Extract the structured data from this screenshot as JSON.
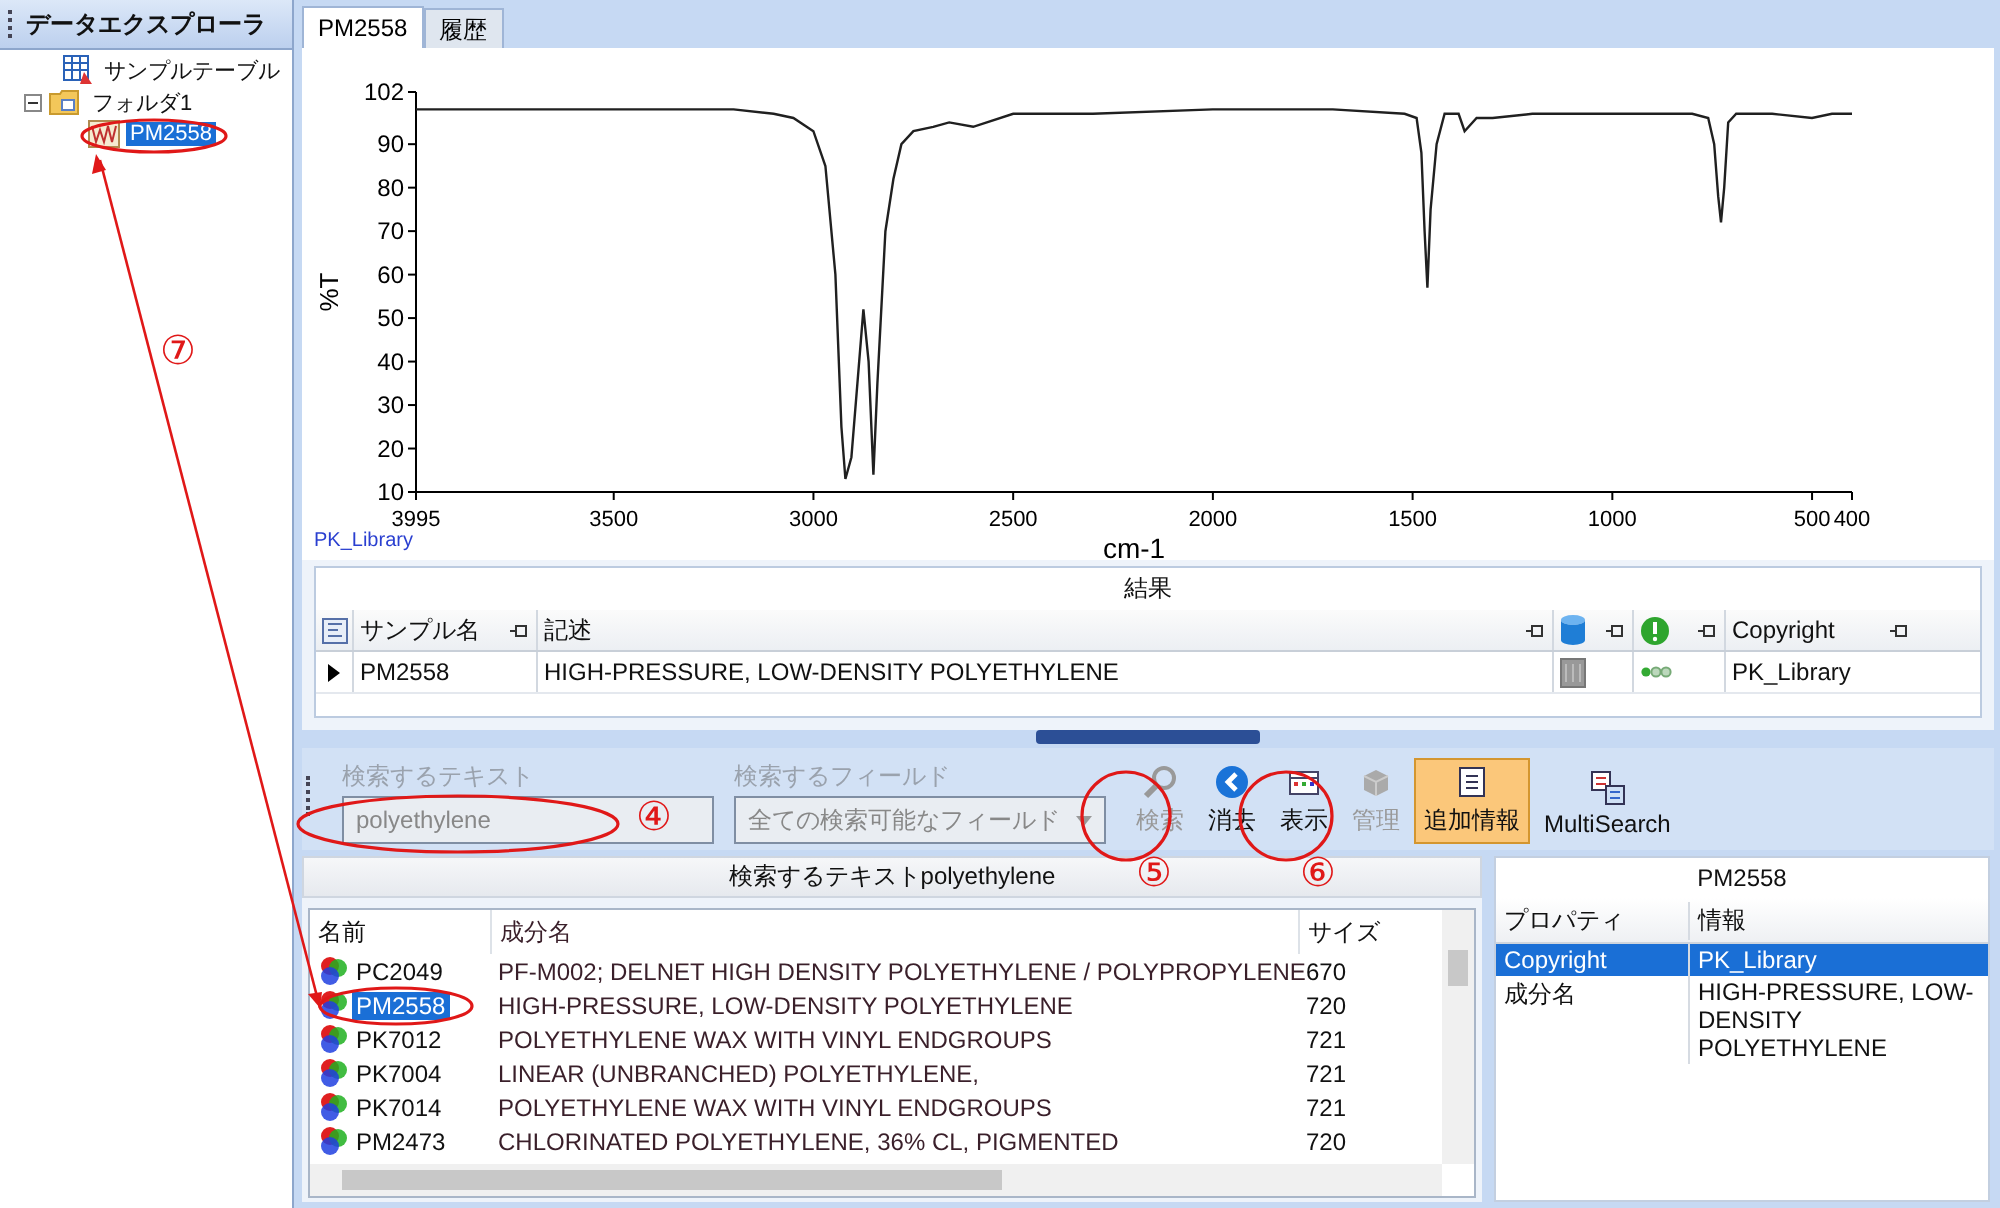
{
  "explorer": {
    "title": "データエクスプローラ",
    "tree": [
      {
        "label": "サンプルテーブル",
        "kind": "table",
        "selected": false
      },
      {
        "label": "フォルダ1",
        "kind": "folder",
        "selected": false,
        "expanded": true,
        "children": [
          {
            "label": "PM2558",
            "kind": "spectrum",
            "selected": true
          }
        ]
      }
    ]
  },
  "tabs": [
    {
      "label": "PM2558",
      "selected": true
    },
    {
      "label": "履歴",
      "selected": false
    }
  ],
  "spectrum": {
    "source": "PK_Library",
    "chart_data": {
      "type": "line",
      "xlabel": "cm-1",
      "ylabel": "%T",
      "x": [
        3995,
        3800,
        3500,
        3200,
        3100,
        3050,
        3000,
        2970,
        2945,
        2930,
        2920,
        2905,
        2890,
        2875,
        2862,
        2850,
        2840,
        2820,
        2800,
        2780,
        2750,
        2700,
        2660,
        2600,
        2500,
        2300,
        2000,
        1700,
        1520,
        1490,
        1478,
        1470,
        1463,
        1455,
        1440,
        1420,
        1400,
        1385,
        1370,
        1340,
        1300,
        1200,
        1000,
        800,
        760,
        745,
        735,
        728,
        720,
        710,
        690,
        600,
        500,
        450,
        400
      ],
      "series": [
        {
          "color": "#202020",
          "values": [
            98,
            98,
            98,
            98,
            97,
            96,
            93,
            85,
            60,
            25,
            13,
            18,
            35,
            52,
            40,
            14,
            35,
            70,
            82,
            90,
            93,
            94,
            95,
            94,
            97,
            97,
            98,
            98,
            97,
            96,
            88,
            70,
            57,
            75,
            90,
            97,
            97,
            97,
            93,
            96,
            96,
            97,
            97,
            97,
            96,
            90,
            78,
            72,
            80,
            95,
            97,
            97,
            96,
            97,
            97
          ]
        }
      ],
      "xlim": [
        3995,
        400
      ],
      "ylim": [
        10,
        102
      ],
      "xticks": [
        3995,
        3500,
        3000,
        2500,
        2000,
        1500,
        1000,
        500,
        400
      ],
      "yticks": [
        10,
        20,
        30,
        40,
        50,
        60,
        70,
        80,
        90,
        102
      ]
    }
  },
  "results": {
    "title": "結果",
    "columns": [
      {
        "kind": "text",
        "label": "サンプル名"
      },
      {
        "kind": "text",
        "label": "記述"
      },
      {
        "kind": "database"
      },
      {
        "kind": "status"
      },
      {
        "kind": "text",
        "label": "Copyright"
      }
    ],
    "rows": [
      {
        "current": true,
        "cells": [
          "PM2558",
          "HIGH-PRESSURE, LOW-DENSITY POLYETHYLENE",
          "PK_Library"
        ]
      }
    ]
  },
  "search": {
    "text_label": "検索するテキスト",
    "text_value": "polyethylene",
    "field_label": "検索するフィールド",
    "field_value": "全ての検索可能なフィールド",
    "disabled": true,
    "buttons": [
      {
        "label": "検索",
        "kind": "search",
        "disabled": true,
        "on": false
      },
      {
        "label": "消去",
        "kind": "clear",
        "disabled": false,
        "on": false
      },
      {
        "label": "表示",
        "kind": "view",
        "disabled": false,
        "on": false
      },
      {
        "label": "管理",
        "kind": "manage",
        "disabled": true,
        "on": false
      },
      {
        "label": "追加情報",
        "kind": "info",
        "disabled": false,
        "on": true
      },
      {
        "label": "MultiSearch",
        "kind": "multisearch",
        "disabled": false,
        "on": false
      }
    ]
  },
  "hits": {
    "title": "検索するテキストpolyethylene",
    "columns": [
      "名前",
      "成分名",
      "サイズ"
    ],
    "rows": [
      {
        "name": "PC2049",
        "component": "PF-M002; DELNET  HIGH DENSITY POLYETHYLENE / POLYPROPYLENE",
        "size": "670",
        "selected": false
      },
      {
        "name": "PM2558",
        "component": "HIGH-PRESSURE, LOW-DENSITY POLYETHYLENE",
        "size": "720",
        "selected": true
      },
      {
        "name": "PK7012",
        "component": "POLYETHYLENE WAX WITH VINYL ENDGROUPS",
        "size": "721",
        "selected": false
      },
      {
        "name": "PK7004",
        "component": "LINEAR (UNBRANCHED) POLYETHYLENE,",
        "size": "721",
        "selected": false
      },
      {
        "name": "PK7014",
        "component": "POLYETHYLENE WAX WITH VINYL ENDGROUPS",
        "size": "721",
        "selected": false
      },
      {
        "name": "PM2473",
        "component": "CHLORINATED POLYETHYLENE, 36% CL, PIGMENTED",
        "size": "720",
        "selected": false
      }
    ]
  },
  "details": {
    "title": "PM2558",
    "columns": [
      "プロパティ",
      "情報"
    ],
    "rows": [
      {
        "property": "Copyright",
        "value": "PK_Library",
        "selected": true
      },
      {
        "property": "成分名",
        "value": "HIGH-PRESSURE, LOW-DENSITY POLYETHYLENE",
        "selected": false
      }
    ]
  },
  "annotations": [
    {
      "label": "④"
    },
    {
      "label": "⑤"
    },
    {
      "label": "⑥"
    },
    {
      "label": "⑦"
    }
  ]
}
